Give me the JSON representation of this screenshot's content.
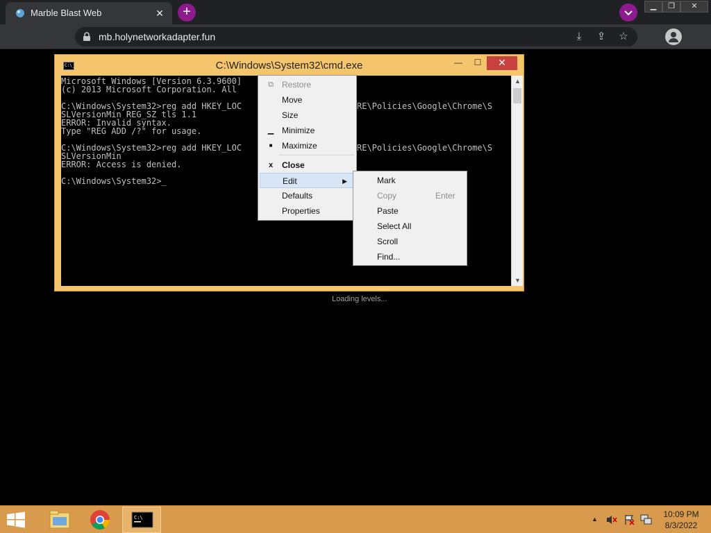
{
  "browser": {
    "tab_title": "Marble Blast Web",
    "tab_close": "✕",
    "new_tab": "+",
    "url": "mb.holynetworkadapter.fun",
    "window_controls": [
      "▁",
      "❐",
      "✕"
    ]
  },
  "cmd": {
    "title": "C:\\Windows\\System32\\cmd.exe",
    "icon_text": "C:\\_",
    "minimize": "—",
    "maximize": "☐",
    "close": "✕",
    "console_text": "Microsoft Windows [Version 6.3.9600]\n(c) 2013 Microsoft Corporation. All\n\nC:\\Windows\\System32>reg add HKEY_LOC\nSLVersionMin REG_SZ tls 1.1\nERROR: Invalid syntax.\nType \"REG ADD /?\" for usage.\n\nC:\\Windows\\System32>reg add HKEY_LOC\nSLVersionMin\nERROR: Access is denied.\n\nC:\\Windows\\System32>_",
    "console_text_right": "RE\\Policies\\Google\\Chrome\\S\n\n\n\n\nRE\\Policies\\Google\\Chrome\\S"
  },
  "system_menu": {
    "items": [
      {
        "label": "Restore",
        "icon": "restore-icon",
        "glyph": "⧉"
      },
      {
        "label": "Move",
        "icon": "",
        "glyph": ""
      },
      {
        "label": "Size",
        "icon": "",
        "glyph": ""
      },
      {
        "label": "Minimize",
        "icon": "minimize-icon",
        "glyph": "▁"
      },
      {
        "label": "Maximize",
        "icon": "maximize-icon",
        "glyph": "■"
      },
      {
        "label": "Close",
        "icon": "close-icon",
        "glyph": "x"
      },
      {
        "label": "Edit",
        "icon": "",
        "glyph": "",
        "submenu_arrow": "▶"
      },
      {
        "label": "Defaults",
        "icon": "",
        "glyph": ""
      },
      {
        "label": "Properties",
        "icon": "",
        "glyph": ""
      }
    ]
  },
  "edit_menu": {
    "items": [
      {
        "label": "Mark"
      },
      {
        "label": "Copy",
        "shortcut": "Enter"
      },
      {
        "label": "Paste"
      },
      {
        "label": "Select All"
      },
      {
        "label": "Scroll"
      },
      {
        "label": "Find..."
      }
    ]
  },
  "page": {
    "loading_text": "Loading levels..."
  },
  "taskbar": {
    "time": "10:09 PM",
    "date": "8/3/2022",
    "tray_arrow": "▲"
  },
  "colors": {
    "cmd_frame": "#f4c56a",
    "taskbar": "#d89b4d",
    "chrome_accent": "#8e1b8e",
    "close_red": "#c7413f"
  }
}
